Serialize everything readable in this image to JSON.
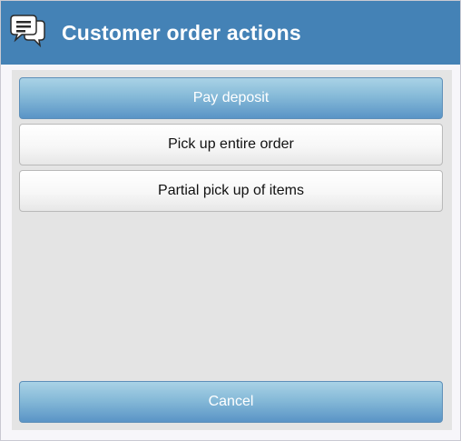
{
  "dialog": {
    "title": "Customer order actions",
    "icon": "chat-bubbles-icon"
  },
  "actions": {
    "pay_deposit": "Pay deposit",
    "pick_up_entire": "Pick up entire order",
    "partial_pick_up": "Partial pick up of items"
  },
  "footer": {
    "cancel": "Cancel"
  },
  "colors": {
    "titlebar": "#4482b6",
    "content_bg": "#e4e4e4",
    "primary_button": "#6fa6d0"
  }
}
